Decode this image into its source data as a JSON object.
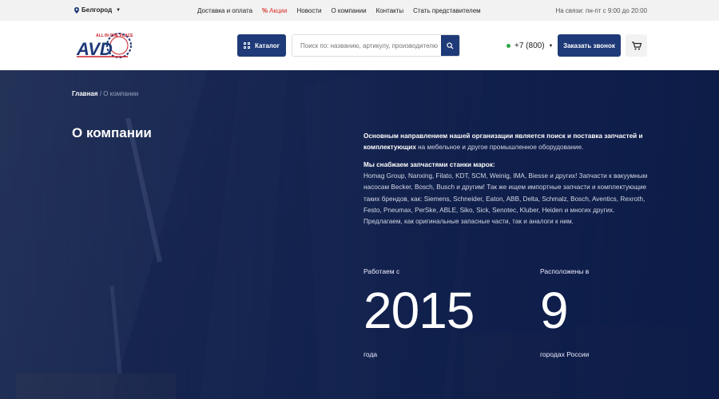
{
  "topbar": {
    "city": "Белгород",
    "nav": [
      "Доставка и оплата",
      "Акции",
      "Новости",
      "О компании",
      "Контакты",
      "Стать представителем"
    ],
    "hours": "На связи: пн-пт с 9:00 до 20:00"
  },
  "header": {
    "logo_tagline": "ALL IN ONE PLACE",
    "logo_text": "AVD",
    "catalog_label": "Каталог",
    "search_placeholder": "Поиск по: названию, артикулу, производителю",
    "phone": "+7 (800)",
    "callback_label": "Заказать звонок"
  },
  "hero": {
    "breadcrumb_home": "Главная",
    "breadcrumb_sep": " / ",
    "breadcrumb_current": "О компании",
    "title": "О компании",
    "p1_bold": "Основным направлением нашей организации является поиск и поставка запчастей и комплектующих",
    "p1_rest": " на мебельное и другое промышленное оборудование.",
    "p2_bold": "Мы снабжаем запчастями станки марок:",
    "p2_rest": "Homag Group, Nanxing, Filato, KDT, SCM, Weinig, IMA, Biesse и других! Запчасти к вакуумным насосам Becker, Bosch, Busch и другим! Так же ищем импортные запчасти и комплектующие таких брендов, как: Siemens, Schneider, Eaton, ABB, Delta, Schmalz, Bosch, Aventics, Rexroth, Festo, Pneumax, PerSke, ABLE, Siko, Sick, Senotec, Kluber, Heiden и многих других. Предлагаем, как оригинальные запасные части, так и аналоги к ним.",
    "stats": [
      {
        "label": "Работаем с",
        "value": "2015",
        "unit": "года"
      },
      {
        "label": "Расположены в",
        "value": "9",
        "unit": "городах России"
      }
    ]
  },
  "colors": {
    "brand": "#1f3a78",
    "promo": "#d9312b",
    "online": "#2fa64a"
  }
}
